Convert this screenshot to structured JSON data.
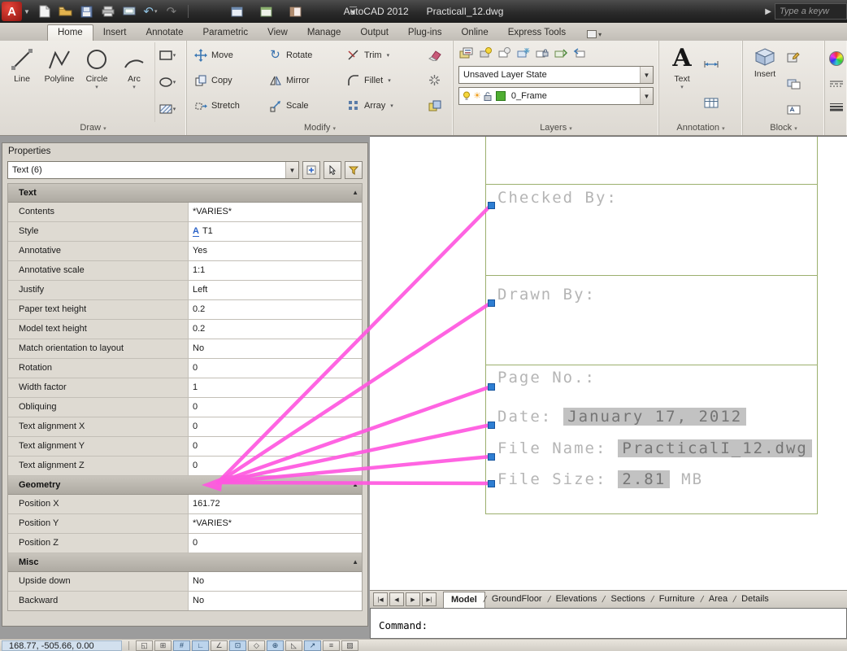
{
  "colors": {
    "accent_magenta": "#ff57e0",
    "grip_blue": "#2e7ed2",
    "frame_green": "#9cb06e",
    "field_gray": "#c2c2c2"
  },
  "title_bar": {
    "app": "AutoCAD 2012",
    "document": "PracticalI_12.dwg",
    "search_placeholder": "Type a keyw"
  },
  "ribbon": {
    "tabs": [
      {
        "label": "Home",
        "active": true
      },
      {
        "label": "Insert",
        "active": false
      },
      {
        "label": "Annotate",
        "active": false
      },
      {
        "label": "Parametric",
        "active": false
      },
      {
        "label": "View",
        "active": false
      },
      {
        "label": "Manage",
        "active": false
      },
      {
        "label": "Output",
        "active": false
      },
      {
        "label": "Plug-ins",
        "active": false
      },
      {
        "label": "Online",
        "active": false
      },
      {
        "label": "Express Tools",
        "active": false
      }
    ],
    "panels": {
      "draw": {
        "label": "Draw",
        "tools": {
          "line": "Line",
          "polyline": "Polyline",
          "circle": "Circle",
          "arc": "Arc"
        }
      },
      "modify": {
        "label": "Modify",
        "tools": {
          "move": "Move",
          "rotate": "Rotate",
          "trim": "Trim",
          "copy": "Copy",
          "mirror": "Mirror",
          "fillet": "Fillet",
          "stretch": "Stretch",
          "scale": "Scale",
          "array": "Array"
        }
      },
      "layers": {
        "label": "Layers",
        "layer_state": "Unsaved Layer State",
        "current_layer": "0_Frame"
      },
      "annotation": {
        "label": "Annotation",
        "text_tool": "Text"
      },
      "block": {
        "label": "Block",
        "insert_tool": "Insert"
      }
    }
  },
  "properties_palette": {
    "title": "Properties",
    "selection": "Text (6)",
    "sections": [
      {
        "name": "Text",
        "rows": [
          {
            "label": "Contents",
            "value": "*VARIES*"
          },
          {
            "label": "Style",
            "value": "T1",
            "icon": "text-style-icon"
          },
          {
            "label": "Annotative",
            "value": "Yes"
          },
          {
            "label": "Annotative scale",
            "value": "1:1"
          },
          {
            "label": "Justify",
            "value": "Left"
          },
          {
            "label": "Paper text height",
            "value": "0.2"
          },
          {
            "label": "Model text height",
            "value": "0.2"
          },
          {
            "label": "Match orientation to layout",
            "value": "No"
          },
          {
            "label": "Rotation",
            "value": "0"
          },
          {
            "label": "Width factor",
            "value": "1"
          },
          {
            "label": "Obliquing",
            "value": "0"
          },
          {
            "label": "Text alignment X",
            "value": "0"
          },
          {
            "label": "Text alignment Y",
            "value": "0"
          },
          {
            "label": "Text alignment Z",
            "value": "0"
          }
        ]
      },
      {
        "name": "Geometry",
        "rows": [
          {
            "label": "Position X",
            "value": "161.72"
          },
          {
            "label": "Position Y",
            "value": "*VARIES*"
          },
          {
            "label": "Position Z",
            "value": "0"
          }
        ]
      },
      {
        "name": "Misc",
        "rows": [
          {
            "label": "Upside down",
            "value": "No"
          },
          {
            "label": "Backward",
            "value": "No"
          }
        ]
      }
    ]
  },
  "drawing": {
    "texts": [
      {
        "label": "Checked By:"
      },
      {
        "label": "Drawn By:"
      },
      {
        "label": "Page No.:"
      },
      {
        "label": "Date:",
        "field": "January 17, 2012"
      },
      {
        "label": "File Name:",
        "field": "PracticalI_12.dwg"
      },
      {
        "label": "File Size:",
        "field": "2.81",
        "suffix": "MB"
      }
    ]
  },
  "layout_tabs": {
    "active": "Model",
    "tabs": [
      "Model",
      "GroundFloor",
      "Elevations",
      "Sections",
      "Furniture",
      "Area",
      "Details"
    ]
  },
  "command_line": {
    "prompt": "Command:"
  },
  "status_bar": {
    "coordinates": "168.77, -505.66, 0.00",
    "toggles": [
      {
        "name": "infer-constraints",
        "glyph": "◱",
        "on": false
      },
      {
        "name": "snap-mode",
        "glyph": "⊞",
        "on": false
      },
      {
        "name": "grid-display",
        "glyph": "#",
        "on": true
      },
      {
        "name": "ortho-mode",
        "glyph": "∟",
        "on": true
      },
      {
        "name": "polar-tracking",
        "glyph": "∠",
        "on": false
      },
      {
        "name": "object-snap",
        "glyph": "⊡",
        "on": true
      },
      {
        "name": "object-snap-3d",
        "glyph": "◇",
        "on": false
      },
      {
        "name": "object-snap-tracking",
        "glyph": "⊕",
        "on": true
      },
      {
        "name": "dynamic-ucs",
        "glyph": "◺",
        "on": false
      },
      {
        "name": "dynamic-input",
        "glyph": "↗",
        "on": true
      },
      {
        "name": "show-lineweight",
        "glyph": "≡",
        "on": false
      },
      {
        "name": "show-transparency",
        "glyph": "▨",
        "on": false
      }
    ]
  }
}
